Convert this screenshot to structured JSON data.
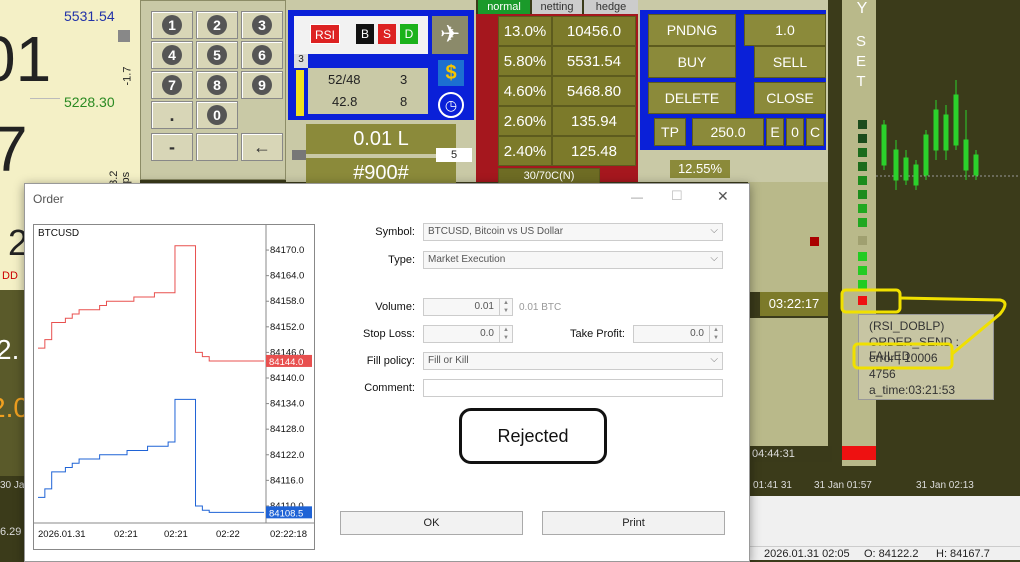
{
  "left_panel": {
    "price_top": "5531.54",
    "price_mid": "5228.30",
    "big_digit_1": "01",
    "big_digit_2": "7",
    "big_digit_3": "2",
    "side_label": "-1.7",
    "pips_label": "63.2 pips",
    "dd_label": "DD",
    "bottom_value_1": "2.",
    "bottom_value_2": "2.0",
    "bottom_edge": "6.29"
  },
  "keypad": {
    "digits": [
      "1",
      "2",
      "3",
      "4",
      "5",
      "6",
      "7",
      "8",
      "9"
    ],
    "dot": ".",
    "zero": "0",
    "colon": ":",
    "minus": "-",
    "back": "←"
  },
  "indicator_panel": {
    "rsi": "RSI",
    "b": "B",
    "s": "S",
    "d": "D",
    "small_3": "3",
    "ratio": "52/48",
    "ratio_val": "3",
    "val_1": "42.8",
    "val_2": "8",
    "lot": "0.01 L",
    "ticket": "#900#",
    "small_5": "5",
    "ratio_bottom": "30/70C(N)"
  },
  "tabs": {
    "normal": "normal",
    "netting": "netting",
    "hedge": "hedge"
  },
  "grid_rows": [
    {
      "pct": "13.0%",
      "val": "10456.0"
    },
    {
      "pct": "5.80%",
      "val": "5531.54"
    },
    {
      "pct": "4.60%",
      "val": "5468.80"
    },
    {
      "pct": "2.60%",
      "val": "135.94"
    },
    {
      "pct": "2.40%",
      "val": "125.48"
    }
  ],
  "trade_panel": {
    "pending": "PNDNG",
    "pending_val": "1.0",
    "buy": "BUY",
    "sell": "SELL",
    "delete": "DELETE",
    "close": "CLOSE",
    "tp": "TP",
    "tp_val": "250.0",
    "e": "E",
    "zero": "0",
    "c": "C",
    "pct_bottom": "12.55%",
    "time": "03:22:17"
  },
  "right_strip": {
    "y": "Y",
    "set": "S E T"
  },
  "log_popup": {
    "line1": "(RSI_DOBLP)",
    "line2": "ORDER_SEND : FAILED",
    "line3": "error | 10006",
    "line4": "4756",
    "line5": "a_time:03:21:53"
  },
  "chart_bottom": {
    "time_1": "04:44:31",
    "axis_labels": [
      "31 Jan 01:41",
      "31 Jan 01:57",
      "31 Jan 02:13"
    ],
    "left_label": "30 Jan 23"
  },
  "statusbar": {
    "date": "2026.01.31 02:05",
    "open": "O: 84122.2",
    "high": "H: 84167.7"
  },
  "dialog": {
    "title": "Order",
    "symbol_label": "Symbol:",
    "symbol_value": "BTCUSD, Bitcoin vs US Dollar",
    "type_label": "Type:",
    "type_value": "Market Execution",
    "volume_label": "Volume:",
    "volume_value": "0.01",
    "volume_unit": "0.01 BTC",
    "sl_label": "Stop Loss:",
    "sl_value": "0.0",
    "tp_label": "Take Profit:",
    "tp_value": "0.0",
    "fill_label": "Fill policy:",
    "fill_value": "Fill or Kill",
    "comment_label": "Comment:",
    "comment_value": "",
    "rejected": "Rejected",
    "ok": "OK",
    "print": "Print",
    "minimize": "—",
    "maximize": "☐",
    "close": "✕"
  },
  "chart_data": {
    "type": "line",
    "title": "BTCUSD",
    "ylim": [
      84106,
      84174
    ],
    "y_ticks": [
      "84170.0",
      "84164.0",
      "84158.0",
      "84152.0",
      "84146.0",
      "84140.0",
      "84134.0",
      "84128.0",
      "84122.0",
      "84116.0",
      "84110.0"
    ],
    "x_ticks": [
      "2026.01.31",
      "02:21",
      "02:21",
      "02:22",
      "02:22:18"
    ],
    "ask_label": "84144.0",
    "bid_label": "84108.5",
    "series": [
      {
        "color": "#e8504f",
        "values": [
          84147,
          84149,
          84153,
          84153,
          84154,
          84155,
          84156,
          84156,
          84156,
          84157,
          84158,
          84158,
          84158,
          84158,
          84159,
          84159,
          84159,
          84160,
          84160,
          84160,
          84171,
          84171,
          84171,
          84146,
          84145,
          84144,
          84144,
          84144,
          84144,
          84144,
          84144,
          84144,
          84144,
          84144
        ]
      },
      {
        "color": "#1f63d6",
        "values": [
          84112,
          84114,
          84118,
          84118,
          84119,
          84120,
          84121,
          84121,
          84121,
          84122,
          84122,
          84122,
          84122,
          84123,
          84123,
          84123,
          84124,
          84124,
          84124,
          84125,
          84135,
          84135,
          84135,
          84110,
          84109,
          84108.5,
          84108.5,
          84108.5,
          84108.5,
          84108.5,
          84108.5,
          84108.5,
          84108.5,
          84108.5
        ]
      }
    ],
    "color_ask": "#e8504f",
    "color_bid": "#1f63d6"
  }
}
